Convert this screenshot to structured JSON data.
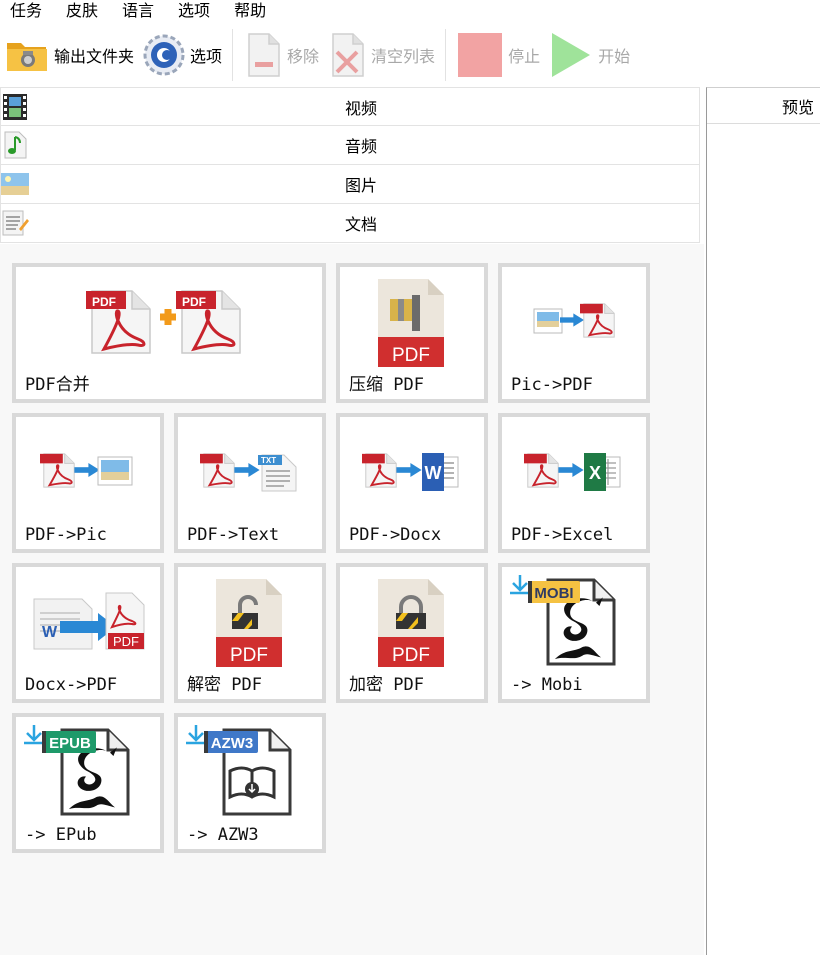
{
  "menu": [
    "任务",
    "皮肤",
    "语言",
    "选项",
    "帮助"
  ],
  "toolbar": {
    "output_folder": "输出文件夹",
    "options": "选项",
    "remove": "移除",
    "clear_list": "清空列表",
    "stop": "停止",
    "start": "开始"
  },
  "categories": [
    {
      "label": "视频",
      "icon": "film-icon"
    },
    {
      "label": "音频",
      "icon": "music-note-icon"
    },
    {
      "label": "图片",
      "icon": "picture-icon"
    },
    {
      "label": "文档",
      "icon": "document-icon"
    }
  ],
  "tiles": [
    {
      "label": "PDF合并",
      "icon": "pdf-merge-icon"
    },
    {
      "label": "压缩 PDF",
      "icon": "pdf-compress-icon"
    },
    {
      "label": "Pic->PDF",
      "icon": "pic-to-pdf-icon"
    },
    {
      "label": "PDF->Pic",
      "icon": "pdf-to-pic-icon"
    },
    {
      "label": "PDF->Text",
      "icon": "pdf-to-text-icon"
    },
    {
      "label": "PDF->Docx",
      "icon": "pdf-to-docx-icon"
    },
    {
      "label": "PDF->Excel",
      "icon": "pdf-to-excel-icon"
    },
    {
      "label": "Docx->PDF",
      "icon": "docx-to-pdf-icon"
    },
    {
      "label": "解密 PDF",
      "icon": "pdf-decrypt-icon"
    },
    {
      "label": "加密 PDF",
      "icon": "pdf-encrypt-icon"
    },
    {
      "label": "-> Mobi",
      "icon": "mobi-icon"
    },
    {
      "label": "-> EPub",
      "icon": "epub-icon"
    },
    {
      "label": "-> AZW3",
      "icon": "azw3-icon"
    }
  ],
  "icon_text": {
    "pdf": "PDF",
    "txt": "TXT",
    "word": "W",
    "excel": "X",
    "mobi": "MOBI",
    "epub": "EPUB",
    "azw3": "AZW3"
  },
  "preview": {
    "title": "预览"
  },
  "colors": {
    "pdf_red": "#c8232c",
    "stop_red": "#f2a3a3",
    "start_green": "#9fe39a",
    "tile_border": "#d9d9d9",
    "mobi_yellow": "#f5c242",
    "epub_green": "#1e9a6a",
    "azw3_blue": "#3f78c8"
  }
}
